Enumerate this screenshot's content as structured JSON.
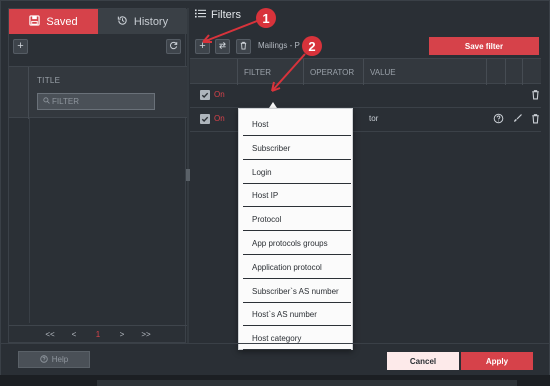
{
  "left": {
    "tabs": [
      {
        "label": "Saved",
        "icon": "save-icon",
        "active": true
      },
      {
        "label": "History",
        "icon": "history-icon",
        "active": false
      }
    ],
    "table": {
      "title_header": "TITLE",
      "filter_placeholder": "FILTER"
    },
    "pagination": {
      "first": "<<",
      "prev": "<",
      "current": "1",
      "next": ">",
      "last": ">>"
    }
  },
  "right": {
    "title": "Filters",
    "breadcrumb": "Mailings - P",
    "save_filter": "Save filter",
    "columns": [
      "FILTER",
      "OPERATOR",
      "VALUE"
    ],
    "rows": [
      {
        "checked": true,
        "state": "On",
        "value": ""
      },
      {
        "checked": true,
        "state": "On",
        "value": "tor"
      }
    ]
  },
  "dropdown": {
    "items": [
      "Host",
      "Subscriber",
      "Login",
      "Host IP",
      "Protocol",
      "App protocols groups",
      "Application protocol",
      "Subscriber`s AS number",
      "Host`s AS number",
      "Host category"
    ]
  },
  "footer": {
    "help": "Help",
    "cancel": "Cancel",
    "apply": "Apply"
  },
  "annotations": {
    "step1": "1",
    "step2": "2"
  },
  "colors": {
    "accent": "#d6424a",
    "background": "#2a2f35",
    "dropdown_bg": "#fbfbfb"
  }
}
